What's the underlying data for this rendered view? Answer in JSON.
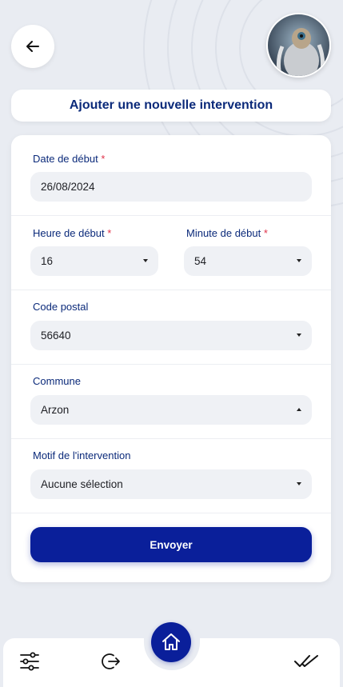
{
  "header": {
    "title": "Ajouter une nouvelle intervention"
  },
  "form": {
    "date": {
      "label": "Date de début",
      "required_mark": "*",
      "value": "26/08/2024"
    },
    "hour": {
      "label": "Heure de début",
      "required_mark": "*",
      "value": "16"
    },
    "minute": {
      "label": "Minute de début",
      "required_mark": "*",
      "value": "54"
    },
    "postal": {
      "label": "Code postal",
      "value": "56640"
    },
    "commune": {
      "label": "Commune",
      "value": "Arzon"
    },
    "motif": {
      "label": "Motif de l'intervention",
      "value": "Aucune sélection"
    },
    "submit_label": "Envoyer"
  },
  "colors": {
    "primary": "#0a1f9a",
    "title_text": "#0b2a7a",
    "required": "#e0334a",
    "background": "#e9ecf2"
  },
  "icons": {
    "back": "arrow-left-icon",
    "dropdown": "caret-down-icon",
    "nav": [
      "filters-icon",
      "logout-icon",
      "home-icon",
      "double-check-icon"
    ]
  }
}
